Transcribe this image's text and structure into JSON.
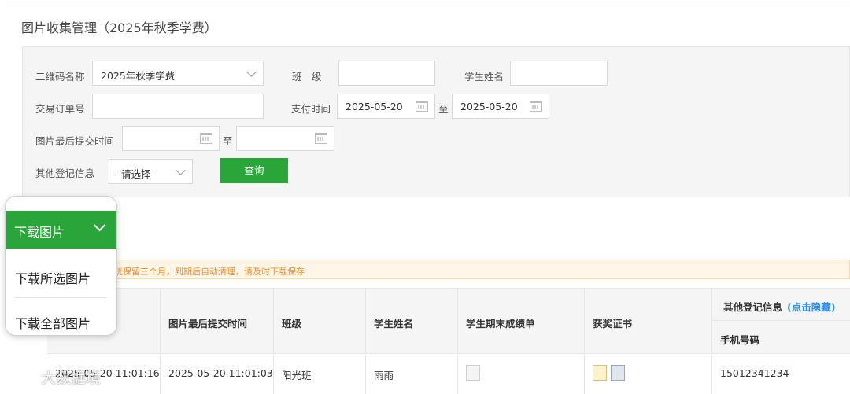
{
  "page": {
    "title": "图片收集管理（2025年秋季学费）"
  },
  "filters": {
    "qrcode_label": "二维码名称",
    "qrcode_value": "2025年秋季学费",
    "class_label": "班　级",
    "class_value": "",
    "student_label": "学生姓名",
    "student_value": "",
    "order_label": "交易订单号",
    "order_value": "",
    "pay_time_label": "支付时间",
    "pay_time_from": "2025-05-20",
    "pay_time_to": "2025-05-20",
    "to_label": "至",
    "img_time_label": "图片最后提交时间",
    "img_time_from": "",
    "img_time_to": "",
    "other_label": "其他登记信息",
    "other_value": "--请选择--",
    "query_label": "查询"
  },
  "notice": {
    "text": "统保留三个月，到期后自动清理，请及时下载保存"
  },
  "dropdown": {
    "head_label": "下载图片",
    "items": [
      {
        "label": "下载所选图片"
      },
      {
        "label": "下载全部图片"
      }
    ]
  },
  "table": {
    "headers": {
      "last_submit": "图片最后提交时间",
      "class": "班级",
      "student": "学生姓名",
      "report": "学生期末成绩单",
      "certificate": "获奖证书",
      "other": "其他登记信息",
      "hide_link": "(点击隐藏)",
      "phone": "手机号码"
    },
    "rows": [
      {
        "pay_time": "2025-05-20 11:01:16",
        "last_submit": "2025-05-20 11:01:03",
        "class": "阳光班",
        "student": "雨雨",
        "phone": "15012341234"
      }
    ]
  },
  "watermark": {
    "text": "大数据境"
  },
  "colors": {
    "accent": "#2aa53a",
    "link": "#2c8cf0",
    "notice": "#ef8f2a"
  },
  "icons": {
    "calendar": "calendar-icon",
    "chevron": "chevron-down-icon",
    "thumbnail": "image-thumbnail-icon"
  }
}
